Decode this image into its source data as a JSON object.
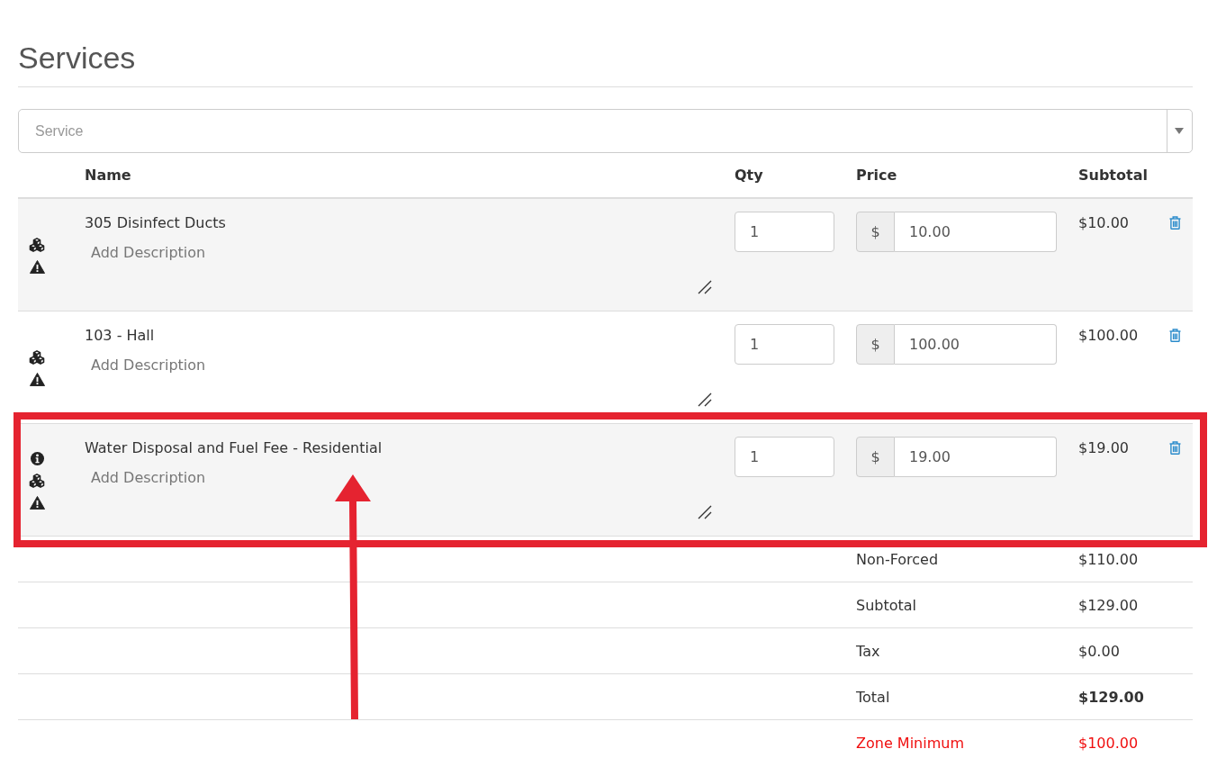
{
  "title": "Services",
  "service_select": {
    "placeholder": "Service"
  },
  "table": {
    "columns": [
      "Name",
      "Qty",
      "Price",
      "Subtotal"
    ],
    "rows": [
      {
        "name": "305 Disinfect Ducts",
        "description_placeholder": "Add Description",
        "qty": "1",
        "currency": "$",
        "price": "10.00",
        "subtotal": "$10.00",
        "info": false,
        "inventory": true,
        "warning": true,
        "highlighted": false
      },
      {
        "name": "103 - Hall",
        "description_placeholder": "Add Description",
        "qty": "1",
        "currency": "$",
        "price": "100.00",
        "subtotal": "$100.00",
        "info": false,
        "inventory": true,
        "warning": true,
        "highlighted": false
      },
      {
        "name": "Water Disposal and Fuel Fee - Residential",
        "description_placeholder": "Add Description",
        "qty": "1",
        "currency": "$",
        "price": "19.00",
        "subtotal": "$19.00",
        "info": true,
        "inventory": true,
        "warning": true,
        "highlighted": true
      }
    ]
  },
  "totals": [
    {
      "label": "Non-Forced",
      "value": "$110.00",
      "kind": "plain"
    },
    {
      "label": "Subtotal",
      "value": "$129.00",
      "kind": "plain"
    },
    {
      "label": "Tax",
      "value": "$0.00",
      "kind": "plain"
    },
    {
      "label": "Total",
      "value": "$129.00",
      "kind": "total"
    },
    {
      "label": "Zone Minimum",
      "value": "$100.00",
      "kind": "alert"
    }
  ]
}
